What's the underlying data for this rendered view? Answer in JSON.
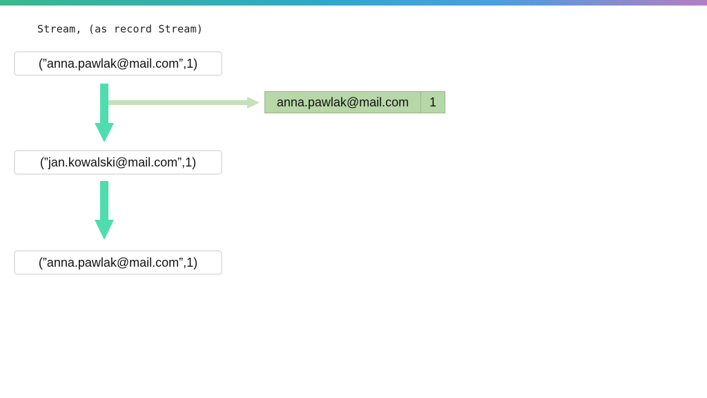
{
  "title": "Stream, (as record Stream)",
  "records": [
    {
      "label": "(”anna.pawlak@mail.com”,1)"
    },
    {
      "label": "(”jan.kowalski@mail.com”,1)"
    },
    {
      "label": "(”anna.pawlak@mail.com”,1)"
    }
  ],
  "state_table": {
    "key": "anna.pawlak@mail.com",
    "value": "1"
  },
  "colors": {
    "flow_arrow": "#4fdcae",
    "side_arrow": "#c5e0bb",
    "table_fill": "#b7d7a8",
    "box_border": "#e4e4e4"
  }
}
